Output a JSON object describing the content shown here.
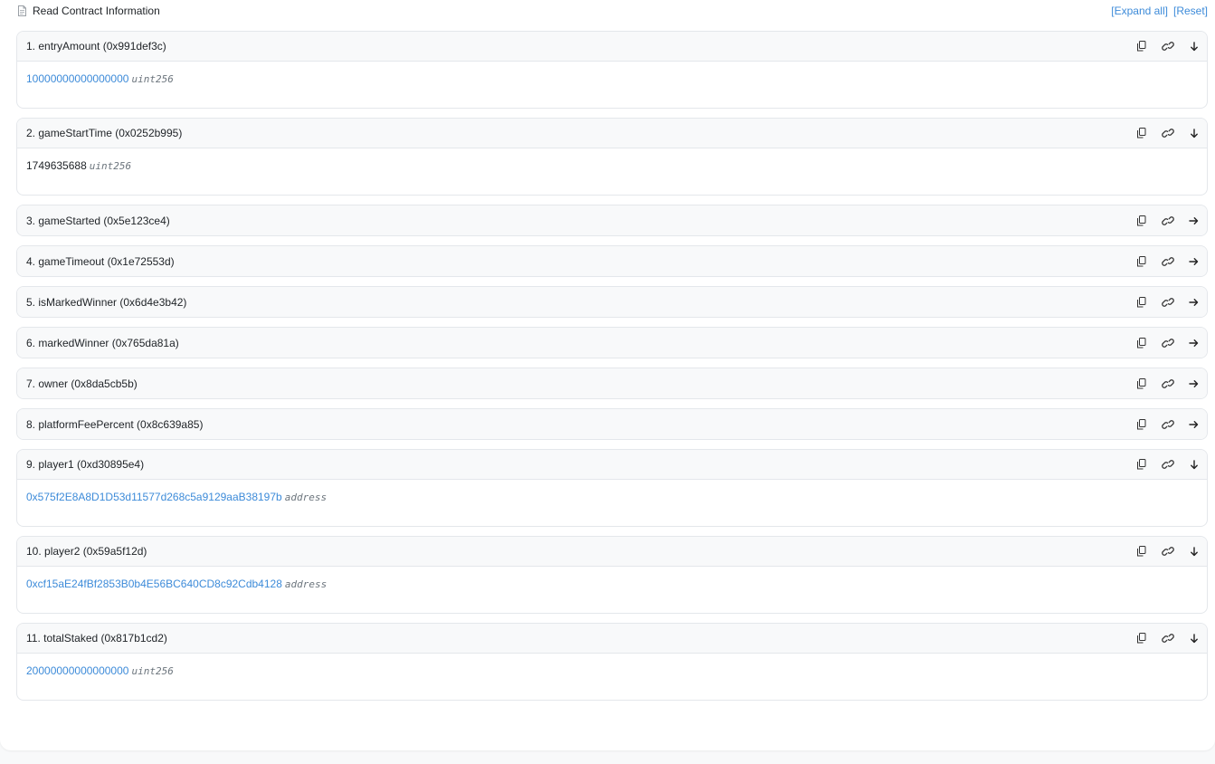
{
  "header": {
    "title": "Read Contract Information",
    "expand_all": "[Expand all]",
    "reset": "[Reset]"
  },
  "functions": [
    {
      "label": "1. entryAmount (0x991def3c)",
      "expanded": true,
      "value": "10000000000000000",
      "value_is_link": true,
      "type": "uint256"
    },
    {
      "label": "2. gameStartTime (0x0252b995)",
      "expanded": true,
      "value": "1749635688",
      "value_is_link": false,
      "type": "uint256"
    },
    {
      "label": "3. gameStarted (0x5e123ce4)",
      "expanded": false
    },
    {
      "label": "4. gameTimeout (0x1e72553d)",
      "expanded": false
    },
    {
      "label": "5. isMarkedWinner (0x6d4e3b42)",
      "expanded": false
    },
    {
      "label": "6. markedWinner (0x765da81a)",
      "expanded": false
    },
    {
      "label": "7. owner (0x8da5cb5b)",
      "expanded": false
    },
    {
      "label": "8. platformFeePercent (0x8c639a85)",
      "expanded": false
    },
    {
      "label": "9. player1 (0xd30895e4)",
      "expanded": true,
      "value": "0x575f2E8A8D1D53d11577d268c5a9129aaB38197b",
      "value_is_link": true,
      "type": "address"
    },
    {
      "label": "10. player2 (0x59a5f12d)",
      "expanded": true,
      "value": "0xcf15aE24fBf2853B0b4E56BC640CD8c92Cdb4128",
      "value_is_link": true,
      "type": "address"
    },
    {
      "label": "11. totalStaked (0x817b1cd2)",
      "expanded": true,
      "value": "20000000000000000",
      "value_is_link": true,
      "type": "uint256"
    }
  ],
  "colors": {
    "link": "#3d8bd9",
    "header_bg": "#f8f9fa",
    "border": "#e4e7eb"
  },
  "icons": {
    "header": "document-icon",
    "copy": "copy-icon",
    "link": "link-icon",
    "expanded_toggle": "arrow-down-icon",
    "collapsed_toggle": "arrow-right-icon"
  }
}
